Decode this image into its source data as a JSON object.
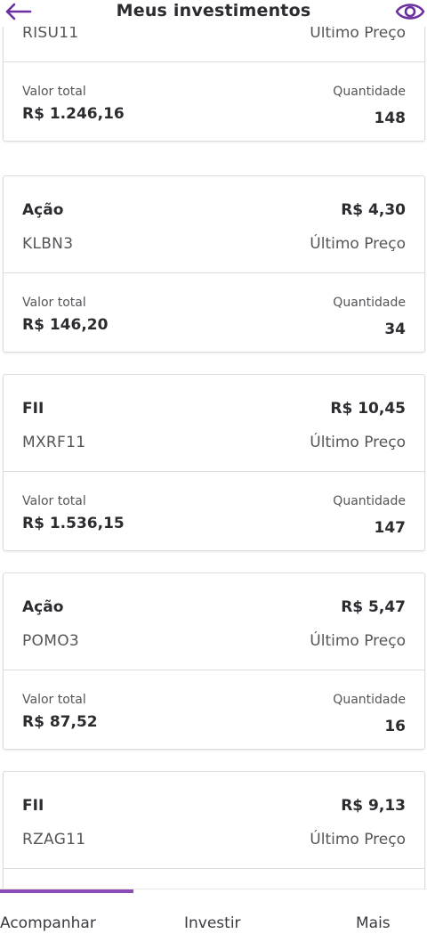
{
  "header": {
    "title": "Meus investimentos"
  },
  "cards": [
    {
      "type": "",
      "price": "",
      "ticker": "RISU11",
      "price_label": "Último Preço",
      "total_label": "Valor total",
      "total_value": "R$ 1.246,16",
      "qty_label": "Quantidade",
      "qty_value": "148"
    },
    {
      "type": "Ação",
      "price": "R$ 4,30",
      "ticker": "KLBN3",
      "price_label": "Último Preço",
      "total_label": "Valor total",
      "total_value": "R$ 146,20",
      "qty_label": "Quantidade",
      "qty_value": "34"
    },
    {
      "type": "FII",
      "price": "R$ 10,45",
      "ticker": "MXRF11",
      "price_label": "Último Preço",
      "total_label": "Valor total",
      "total_value": "R$ 1.536,15",
      "qty_label": "Quantidade",
      "qty_value": "147"
    },
    {
      "type": "Ação",
      "price": "R$ 5,47",
      "ticker": "POMO3",
      "price_label": "Último Preço",
      "total_label": "Valor total",
      "total_value": "R$ 87,52",
      "qty_label": "Quantidade",
      "qty_value": "16"
    },
    {
      "type": "FII",
      "price": "R$ 9,13",
      "ticker": "RZAG11",
      "price_label": "Último Preço",
      "total_label": "",
      "total_value": "",
      "qty_label": "",
      "qty_value": ""
    }
  ],
  "bottom_nav": {
    "items": [
      {
        "label": "Acompanhar"
      },
      {
        "label": "Investir"
      },
      {
        "label": "Mais"
      }
    ],
    "active_index": 0
  },
  "icons": {
    "back": "arrow-left-icon",
    "visibility": "eye-icon"
  },
  "colors": {
    "accent": "#6b2fa0",
    "indicator": "#8a4db8"
  }
}
